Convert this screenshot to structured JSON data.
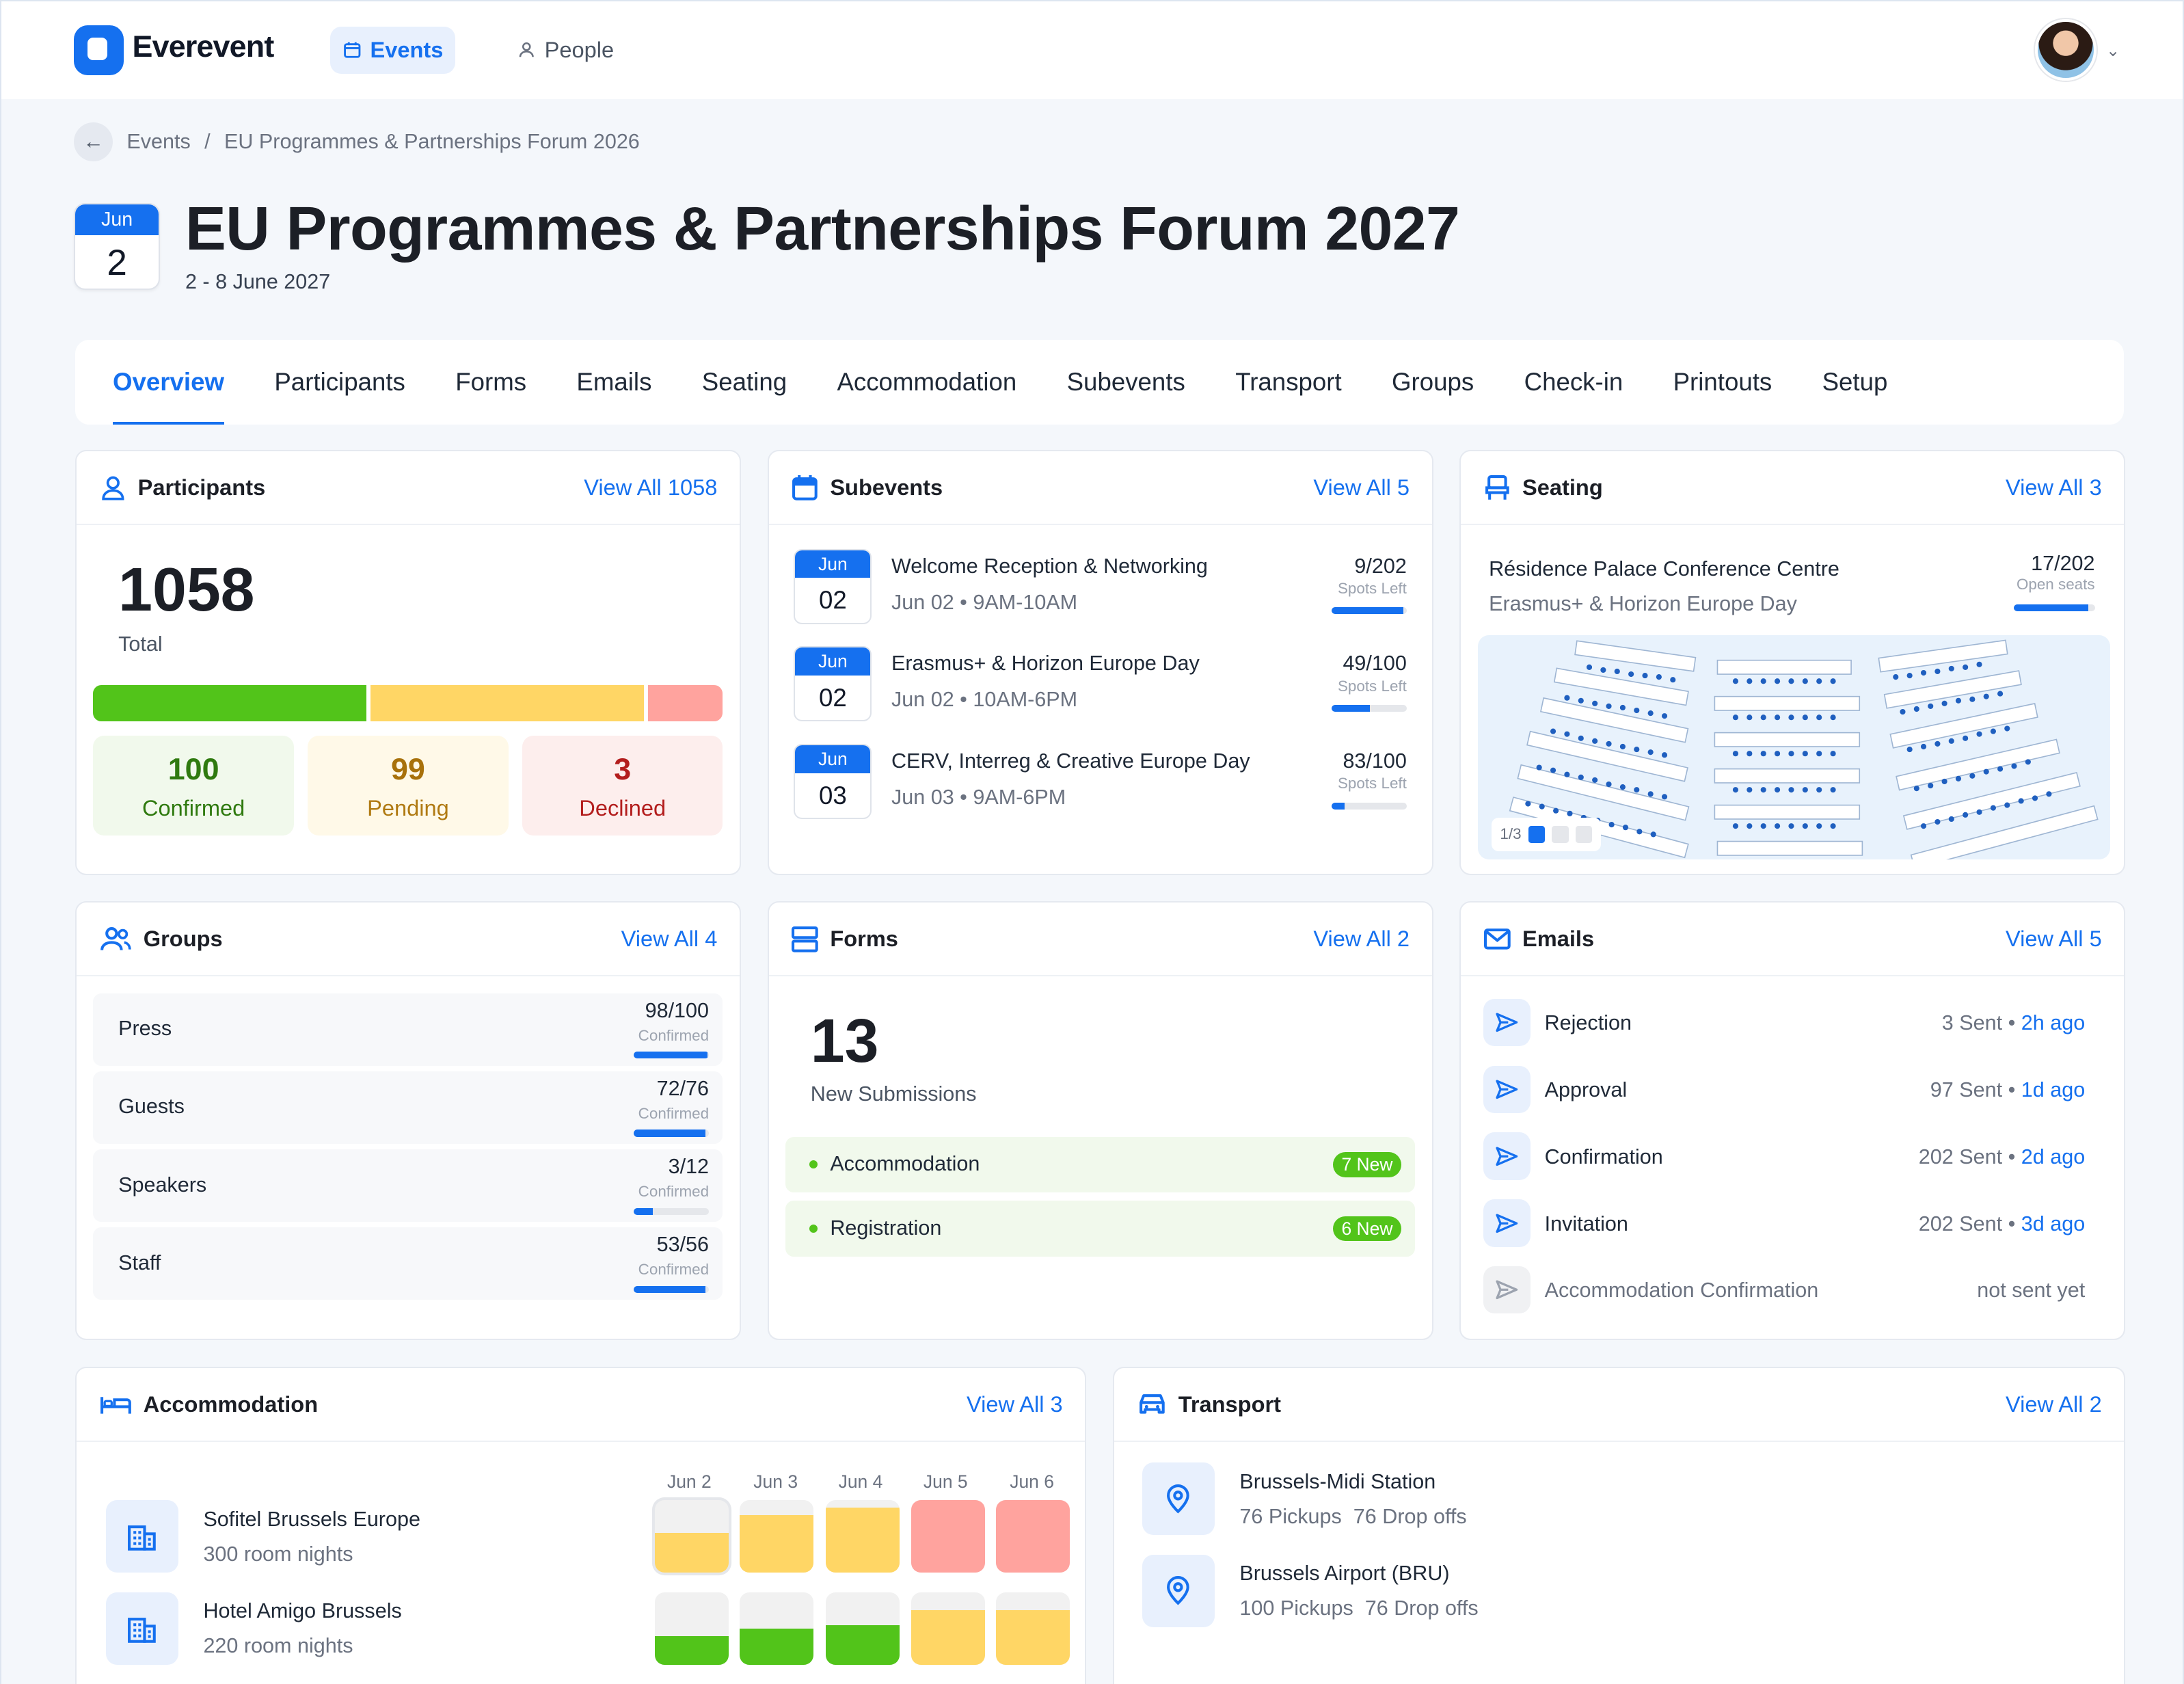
{
  "app": {
    "brand": "Everevent",
    "nav": {
      "events": "Events",
      "people": "People"
    }
  },
  "breadcrumb": {
    "root": "Events",
    "sep": "/",
    "current": "EU Programmes & Partnerships Forum 2026"
  },
  "event": {
    "month": "Jun",
    "day": "2",
    "title": "EU Programmes & Partnerships Forum 2027",
    "dates": "2 - 8 June 2027"
  },
  "tabs": [
    "Overview",
    "Participants",
    "Forms",
    "Emails",
    "Seating",
    "Accommodation",
    "Subevents",
    "Transport",
    "Groups",
    "Check-in",
    "Printouts",
    "Setup"
  ],
  "participants": {
    "title": "Participants",
    "link": "View All 1058",
    "total": "1058",
    "total_label": "Total",
    "bar_shares": [
      0.44,
      0.44,
      0.12
    ],
    "confirmed": {
      "value": "100",
      "label": "Confirmed"
    },
    "pending": {
      "value": "99",
      "label": "Pending"
    },
    "declined": {
      "value": "3",
      "label": "Declined"
    }
  },
  "subevents": {
    "title": "Subevents",
    "link": "View All 5",
    "spots_caption": "Spots Left",
    "items": [
      {
        "month": "Jun",
        "day": "02",
        "name": "Welcome Reception & Networking",
        "time": "Jun 02 • 9AM-10AM",
        "spots": "9/202",
        "fill": 0.96
      },
      {
        "month": "Jun",
        "day": "02",
        "name": "Erasmus+ & Horizon Europe Day",
        "time": "Jun 02 • 10AM-6PM",
        "spots": "49/100",
        "fill": 0.51
      },
      {
        "month": "Jun",
        "day": "03",
        "name": "CERV, Interreg & Creative Europe Day",
        "time": "Jun 03 • 9AM-6PM",
        "spots": "83/100",
        "fill": 0.17
      }
    ]
  },
  "seating": {
    "title": "Seating",
    "link": "View All 3",
    "venue": "Résidence Palace Conference Centre",
    "subevent": "Erasmus+ & Horizon Europe Day",
    "seats": "17/202",
    "seats_caption": "Open seats",
    "fill": 0.92,
    "pager": "1/3"
  },
  "groups": {
    "title": "Groups",
    "link": "View All 4",
    "caption": "Confirmed",
    "items": [
      {
        "name": "Press",
        "count": "98/100",
        "fill": 0.98
      },
      {
        "name": "Guests",
        "count": "72/76",
        "fill": 0.95
      },
      {
        "name": "Speakers",
        "count": "3/12",
        "fill": 0.25
      },
      {
        "name": "Staff",
        "count": "53/56",
        "fill": 0.95
      }
    ]
  },
  "forms": {
    "title": "Forms",
    "link": "View All 2",
    "count": "13",
    "count_label": "New Submissions",
    "items": [
      {
        "name": "Accommodation",
        "badge": "7 New"
      },
      {
        "name": "Registration",
        "badge": "6 New"
      }
    ]
  },
  "emails": {
    "title": "Emails",
    "link": "View All 5",
    "items": [
      {
        "name": "Rejection",
        "sent": "3 Sent",
        "ago": "2h ago"
      },
      {
        "name": "Approval",
        "sent": "97 Sent",
        "ago": "1d ago"
      },
      {
        "name": "Confirmation",
        "sent": "202 Sent",
        "ago": "2d ago"
      },
      {
        "name": "Invitation",
        "sent": "202 Sent",
        "ago": "3d ago"
      },
      {
        "name": "Accommodation Confirmation",
        "sent": "not sent yet",
        "ago": ""
      }
    ]
  },
  "accommodation": {
    "title": "Accommodation",
    "link": "View All 3",
    "days": [
      "Jun 2",
      "Jun 3",
      "Jun 4",
      "Jun 5",
      "Jun 6"
    ],
    "hotels": [
      {
        "name": "Sofitel Brussels Europe",
        "nights": "300 room nights",
        "cells": [
          {
            "fill": 0.55,
            "color": "#ffd665"
          },
          {
            "fill": 0.8,
            "color": "#ffd665"
          },
          {
            "fill": 0.9,
            "color": "#ffd665"
          },
          {
            "fill": 1.0,
            "color": "#ffa39e"
          },
          {
            "fill": 1.0,
            "color": "#ffa39e"
          }
        ]
      },
      {
        "name": "Hotel Amigo Brussels",
        "nights": "220 room nights",
        "cells": [
          {
            "fill": 0.4,
            "color": "#52c41a"
          },
          {
            "fill": 0.5,
            "color": "#52c41a"
          },
          {
            "fill": 0.55,
            "color": "#52c41a"
          },
          {
            "fill": 0.75,
            "color": "#ffd665"
          },
          {
            "fill": 0.75,
            "color": "#ffd665"
          }
        ]
      }
    ]
  },
  "transport": {
    "title": "Transport",
    "link": "View All 2",
    "items": [
      {
        "name": "Brussels-Midi Station",
        "pickups": "76 Pickups",
        "dropoffs": "76 Drop offs"
      },
      {
        "name": "Brussels Airport (BRU)",
        "pickups": "100 Pickups",
        "dropoffs": "76 Drop offs"
      }
    ]
  },
  "colors": {
    "accent": "#1570ef",
    "confirmed": "#52c41a",
    "pending": "#ffd665",
    "declined": "#ffa39e"
  },
  "icons": [
    "calendar-icon",
    "user-icon",
    "seat-icon",
    "groups-icon",
    "forms-icon",
    "mail-icon",
    "bed-icon",
    "car-icon",
    "send-icon",
    "building-icon",
    "map-pin-icon",
    "arrow-left-icon",
    "chevron-down-icon"
  ]
}
